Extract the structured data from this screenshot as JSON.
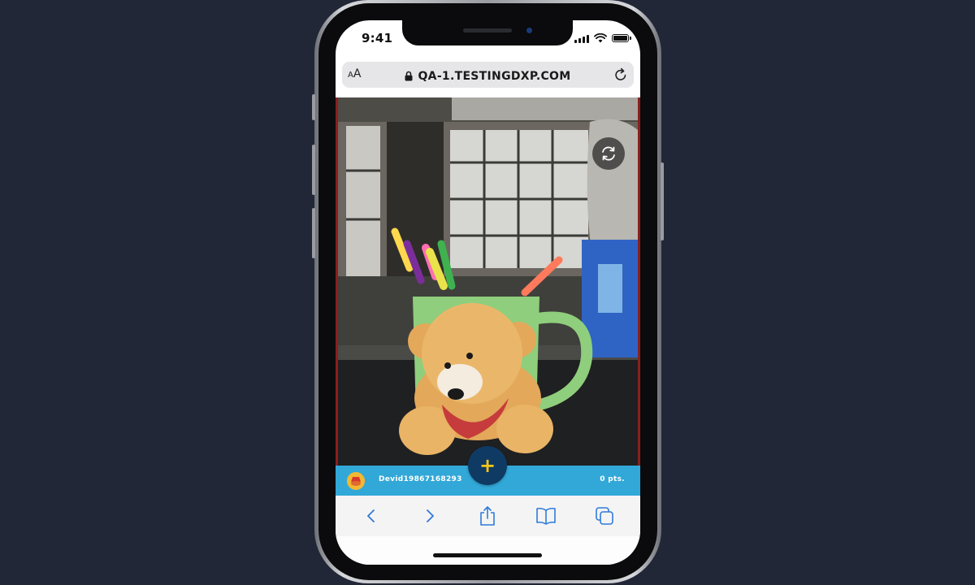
{
  "status_bar": {
    "time": "9:41"
  },
  "browser": {
    "text_size_label_small": "A",
    "text_size_label_large": "A",
    "url": "QA-1.TESTINGDXP.COM",
    "icons": {
      "lock": "lock-icon",
      "reload": "reload-icon"
    }
  },
  "camera": {
    "flip_icon": "flip-camera-icon"
  },
  "score_bar": {
    "username": "Devid19867168293",
    "points": "0 pts.",
    "add_label": "+"
  },
  "toolbar": {
    "items": [
      "back-icon",
      "forward-icon",
      "share-icon",
      "bookmarks-icon",
      "tabs-icon"
    ]
  },
  "colors": {
    "background": "#222737",
    "score_bar": "#32a8d8",
    "add_button": "#0f3a63",
    "add_plus": "#f5c518",
    "toolbar_icons": "#2f7bd8"
  }
}
